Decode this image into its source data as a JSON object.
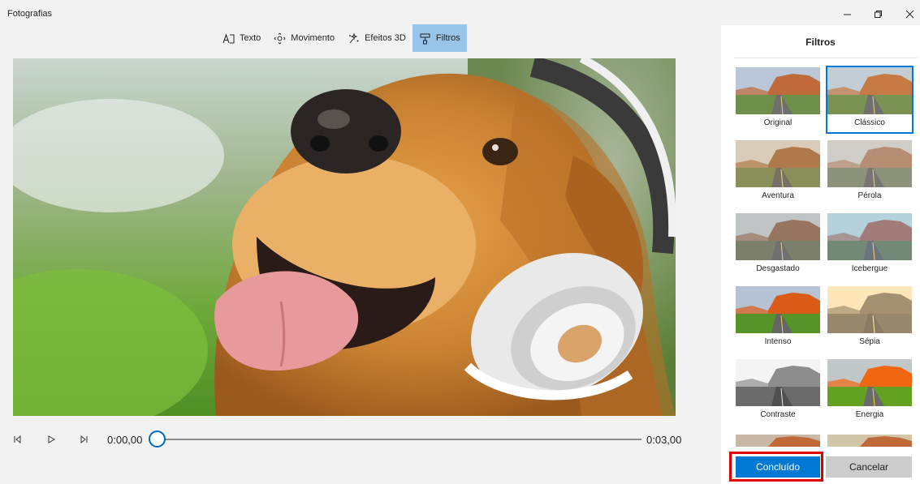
{
  "window": {
    "title": "Fotografias",
    "controls": [
      "minimize-icon",
      "restore-icon",
      "close-icon"
    ]
  },
  "toolbar": {
    "items": [
      {
        "label": "Texto",
        "icon": "text-icon",
        "active": false
      },
      {
        "label": "Movimento",
        "icon": "motion-icon",
        "active": false
      },
      {
        "label": "Efeitos 3D",
        "icon": "effects-3d-icon",
        "active": false
      },
      {
        "label": "Filtros",
        "icon": "filter-icon",
        "active": true
      }
    ]
  },
  "playback": {
    "current_time": "0:00,00",
    "total_time": "0:03,00",
    "progress": 0.0
  },
  "filters_panel": {
    "title": "Filtros",
    "items": [
      {
        "label": "Original",
        "selected": false
      },
      {
        "label": "Clássico",
        "selected": true
      },
      {
        "label": "Aventura",
        "selected": false
      },
      {
        "label": "Pérola",
        "selected": false
      },
      {
        "label": "Desgastado",
        "selected": false
      },
      {
        "label": "Icebergue",
        "selected": false
      },
      {
        "label": "Intenso",
        "selected": false
      },
      {
        "label": "Sépia",
        "selected": false
      },
      {
        "label": "Contraste",
        "selected": false
      },
      {
        "label": "Energia",
        "selected": false
      }
    ],
    "done_label": "Concluído",
    "cancel_label": "Cancelar"
  },
  "colors": {
    "accent": "#0078d4",
    "toolbar_active": "#99c5ea",
    "highlight_outline": "#e00000"
  }
}
